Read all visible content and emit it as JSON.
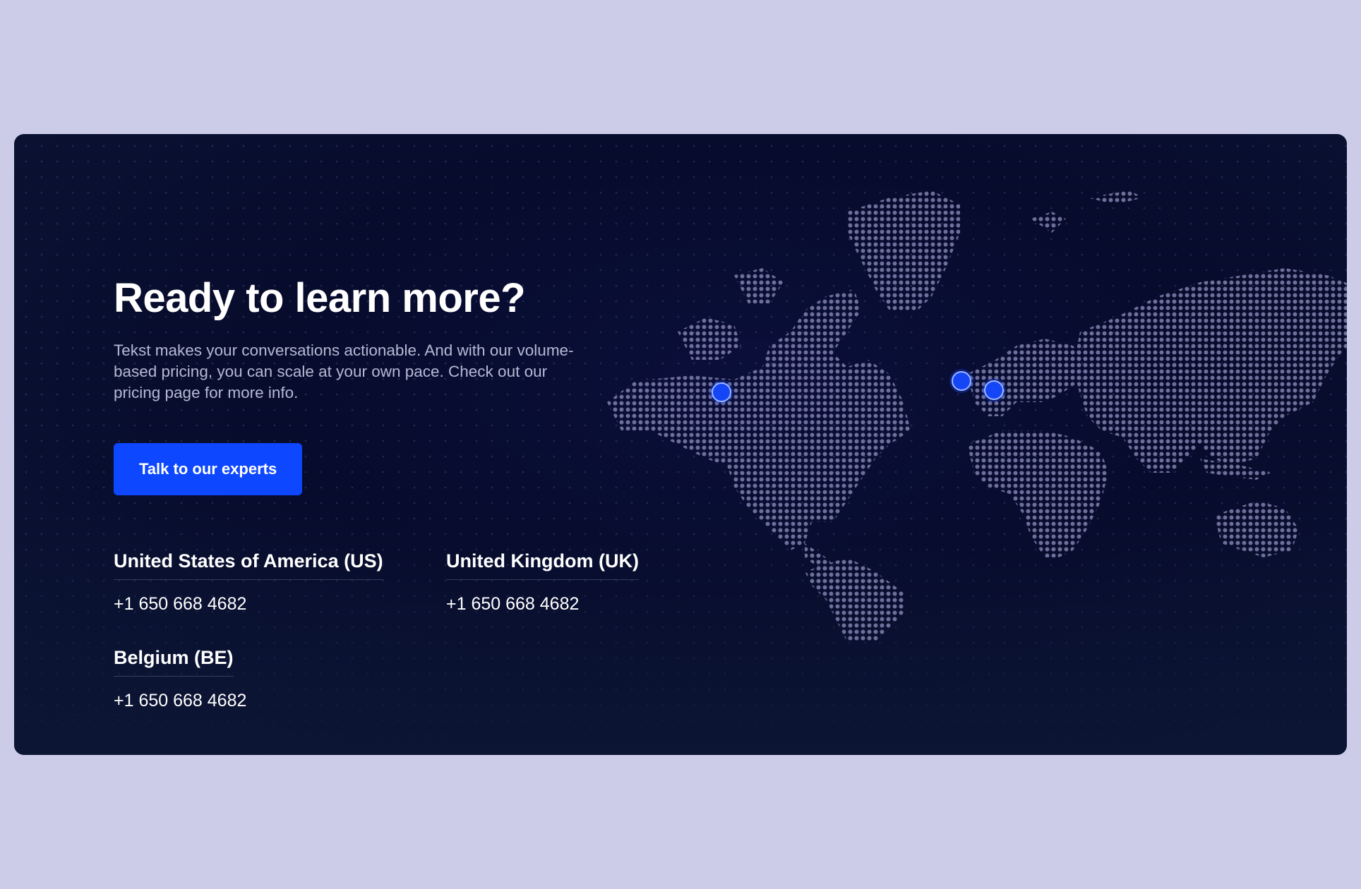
{
  "cta_section": {
    "headline": "Ready to learn more?",
    "intro": "Tekst makes your conversations actionable. And with our volume-based pricing, you can scale at your own pace. Check out our pricing page for more info.",
    "button_label": "Talk to our experts",
    "offices": [
      {
        "name": "United States of America (US)",
        "phone": "+1 650 668 4682"
      },
      {
        "name": "United Kingdom (UK)",
        "phone": "+1 650 668 4682"
      },
      {
        "name": "Belgium (BE)",
        "phone": "+1 650 668 4682"
      }
    ]
  },
  "map": {
    "icon": "dotted-world-map",
    "pins": [
      "us-location-pin",
      "uk-location-pin",
      "be-location-pin"
    ]
  },
  "colors": {
    "page_background": "#cccce8",
    "card_background": "#070b2c",
    "accent": "#0d47ff",
    "map_dot": "#6e6f9a",
    "pin": "#1446f5"
  }
}
